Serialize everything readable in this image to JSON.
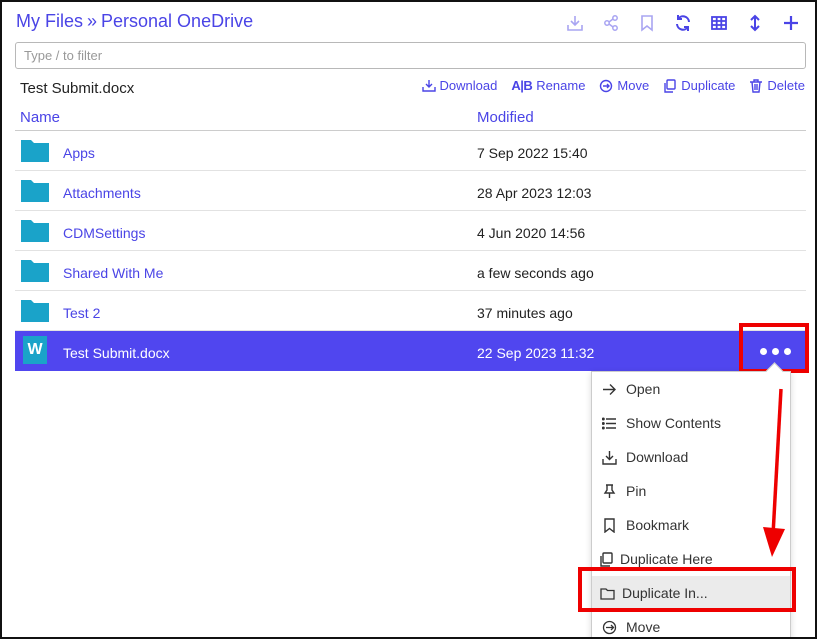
{
  "breadcrumb": {
    "root": "My Files",
    "separator": "»",
    "current": "Personal OneDrive"
  },
  "toolbar_icons": [
    "download-icon",
    "share-icon",
    "bookmark-icon",
    "refresh-icon",
    "grid-view-icon",
    "sort-icon",
    "add-icon"
  ],
  "filter": {
    "placeholder": "Type / to filter",
    "value": ""
  },
  "selected": {
    "name": "Test Submit.docx"
  },
  "actions": {
    "download": "Download",
    "rename_prefix": "A|B",
    "rename": "Rename",
    "move": "Move",
    "duplicate": "Duplicate",
    "delete": "Delete"
  },
  "columns": {
    "name": "Name",
    "modified": "Modified"
  },
  "rows": [
    {
      "name": "Apps",
      "modified": "7 Sep 2022 15:40",
      "type": "folder"
    },
    {
      "name": "Attachments",
      "modified": "28 Apr 2023 12:03",
      "type": "folder"
    },
    {
      "name": "CDMSettings",
      "modified": "4 Jun 2020 14:56",
      "type": "folder"
    },
    {
      "name": "Shared With Me",
      "modified": "a few seconds ago",
      "type": "folder"
    },
    {
      "name": "Test 2",
      "modified": "37 minutes ago",
      "type": "folder"
    },
    {
      "name": "Test Submit.docx",
      "modified": "22 Sep 2023 11:32",
      "type": "word",
      "icon_letter": "W"
    }
  ],
  "menu": [
    {
      "label": "Open",
      "icon": "arrow-right-icon"
    },
    {
      "label": "Show Contents",
      "icon": "list-icon"
    },
    {
      "label": "Download",
      "icon": "download-icon"
    },
    {
      "label": "Pin",
      "icon": "pin-icon"
    },
    {
      "label": "Bookmark",
      "icon": "bookmark-icon"
    },
    {
      "label": "Duplicate Here",
      "icon": "copy-icon"
    },
    {
      "label": "Duplicate In...",
      "icon": "folder-icon"
    },
    {
      "label": "Move",
      "icon": "move-icon"
    }
  ],
  "colors": {
    "accent": "#4a44e6",
    "selected_row": "#5046ef",
    "folder": "#1aa3c9",
    "highlight": "#ee0000"
  }
}
